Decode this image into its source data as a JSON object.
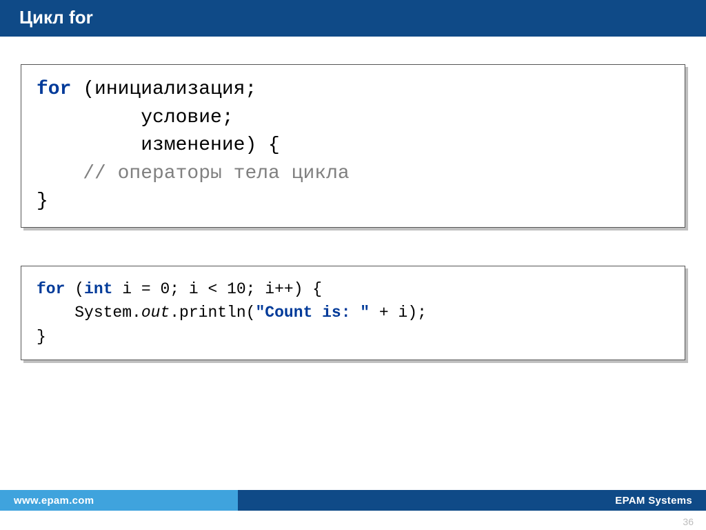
{
  "header": {
    "title": "Цикл for"
  },
  "code1": {
    "kw_for": "for",
    "l1_rest": " (инициализация;",
    "l2": "         условие;",
    "l3": "         изменение) {",
    "l4": "    // операторы тела цикла",
    "l5": "}"
  },
  "code2": {
    "kw_for": "for",
    "l1a": " (",
    "kw_int": "int",
    "l1b": " i = 0; i < 10; i++) {",
    "l2a": "    System.",
    "out": "out",
    "l2b": ".println(",
    "str": "\"Count is: \"",
    "l2c": " + i);",
    "l3": "}"
  },
  "footer": {
    "left": "www.epam.com",
    "right": "EPAM Systems"
  },
  "page": "36"
}
